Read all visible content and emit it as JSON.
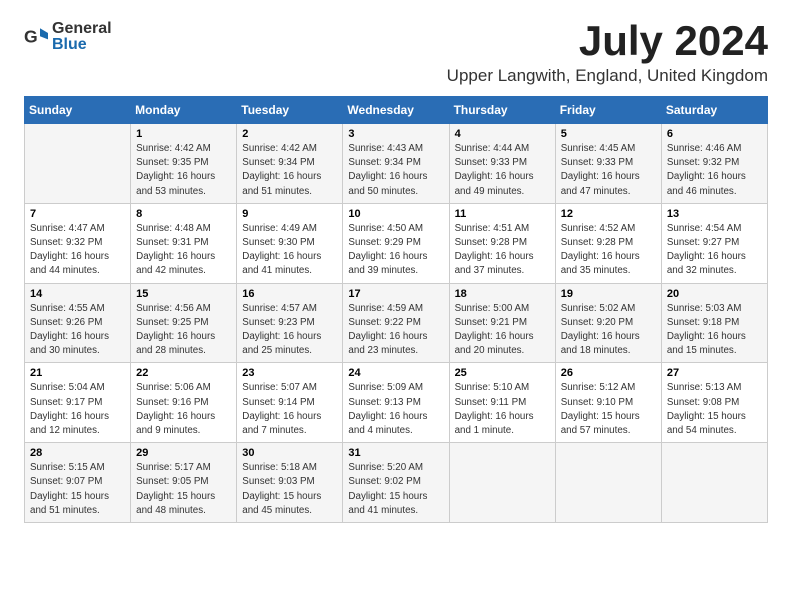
{
  "header": {
    "logo_general": "General",
    "logo_blue": "Blue",
    "month": "July 2024",
    "location": "Upper Langwith, England, United Kingdom"
  },
  "weekdays": [
    "Sunday",
    "Monday",
    "Tuesday",
    "Wednesday",
    "Thursday",
    "Friday",
    "Saturday"
  ],
  "weeks": [
    [
      {
        "day": "",
        "info": ""
      },
      {
        "day": "1",
        "info": "Sunrise: 4:42 AM\nSunset: 9:35 PM\nDaylight: 16 hours\nand 53 minutes."
      },
      {
        "day": "2",
        "info": "Sunrise: 4:42 AM\nSunset: 9:34 PM\nDaylight: 16 hours\nand 51 minutes."
      },
      {
        "day": "3",
        "info": "Sunrise: 4:43 AM\nSunset: 9:34 PM\nDaylight: 16 hours\nand 50 minutes."
      },
      {
        "day": "4",
        "info": "Sunrise: 4:44 AM\nSunset: 9:33 PM\nDaylight: 16 hours\nand 49 minutes."
      },
      {
        "day": "5",
        "info": "Sunrise: 4:45 AM\nSunset: 9:33 PM\nDaylight: 16 hours\nand 47 minutes."
      },
      {
        "day": "6",
        "info": "Sunrise: 4:46 AM\nSunset: 9:32 PM\nDaylight: 16 hours\nand 46 minutes."
      }
    ],
    [
      {
        "day": "7",
        "info": "Sunrise: 4:47 AM\nSunset: 9:32 PM\nDaylight: 16 hours\nand 44 minutes."
      },
      {
        "day": "8",
        "info": "Sunrise: 4:48 AM\nSunset: 9:31 PM\nDaylight: 16 hours\nand 42 minutes."
      },
      {
        "day": "9",
        "info": "Sunrise: 4:49 AM\nSunset: 9:30 PM\nDaylight: 16 hours\nand 41 minutes."
      },
      {
        "day": "10",
        "info": "Sunrise: 4:50 AM\nSunset: 9:29 PM\nDaylight: 16 hours\nand 39 minutes."
      },
      {
        "day": "11",
        "info": "Sunrise: 4:51 AM\nSunset: 9:28 PM\nDaylight: 16 hours\nand 37 minutes."
      },
      {
        "day": "12",
        "info": "Sunrise: 4:52 AM\nSunset: 9:28 PM\nDaylight: 16 hours\nand 35 minutes."
      },
      {
        "day": "13",
        "info": "Sunrise: 4:54 AM\nSunset: 9:27 PM\nDaylight: 16 hours\nand 32 minutes."
      }
    ],
    [
      {
        "day": "14",
        "info": "Sunrise: 4:55 AM\nSunset: 9:26 PM\nDaylight: 16 hours\nand 30 minutes."
      },
      {
        "day": "15",
        "info": "Sunrise: 4:56 AM\nSunset: 9:25 PM\nDaylight: 16 hours\nand 28 minutes."
      },
      {
        "day": "16",
        "info": "Sunrise: 4:57 AM\nSunset: 9:23 PM\nDaylight: 16 hours\nand 25 minutes."
      },
      {
        "day": "17",
        "info": "Sunrise: 4:59 AM\nSunset: 9:22 PM\nDaylight: 16 hours\nand 23 minutes."
      },
      {
        "day": "18",
        "info": "Sunrise: 5:00 AM\nSunset: 9:21 PM\nDaylight: 16 hours\nand 20 minutes."
      },
      {
        "day": "19",
        "info": "Sunrise: 5:02 AM\nSunset: 9:20 PM\nDaylight: 16 hours\nand 18 minutes."
      },
      {
        "day": "20",
        "info": "Sunrise: 5:03 AM\nSunset: 9:18 PM\nDaylight: 16 hours\nand 15 minutes."
      }
    ],
    [
      {
        "day": "21",
        "info": "Sunrise: 5:04 AM\nSunset: 9:17 PM\nDaylight: 16 hours\nand 12 minutes."
      },
      {
        "day": "22",
        "info": "Sunrise: 5:06 AM\nSunset: 9:16 PM\nDaylight: 16 hours\nand 9 minutes."
      },
      {
        "day": "23",
        "info": "Sunrise: 5:07 AM\nSunset: 9:14 PM\nDaylight: 16 hours\nand 7 minutes."
      },
      {
        "day": "24",
        "info": "Sunrise: 5:09 AM\nSunset: 9:13 PM\nDaylight: 16 hours\nand 4 minutes."
      },
      {
        "day": "25",
        "info": "Sunrise: 5:10 AM\nSunset: 9:11 PM\nDaylight: 16 hours\nand 1 minute."
      },
      {
        "day": "26",
        "info": "Sunrise: 5:12 AM\nSunset: 9:10 PM\nDaylight: 15 hours\nand 57 minutes."
      },
      {
        "day": "27",
        "info": "Sunrise: 5:13 AM\nSunset: 9:08 PM\nDaylight: 15 hours\nand 54 minutes."
      }
    ],
    [
      {
        "day": "28",
        "info": "Sunrise: 5:15 AM\nSunset: 9:07 PM\nDaylight: 15 hours\nand 51 minutes."
      },
      {
        "day": "29",
        "info": "Sunrise: 5:17 AM\nSunset: 9:05 PM\nDaylight: 15 hours\nand 48 minutes."
      },
      {
        "day": "30",
        "info": "Sunrise: 5:18 AM\nSunset: 9:03 PM\nDaylight: 15 hours\nand 45 minutes."
      },
      {
        "day": "31",
        "info": "Sunrise: 5:20 AM\nSunset: 9:02 PM\nDaylight: 15 hours\nand 41 minutes."
      },
      {
        "day": "",
        "info": ""
      },
      {
        "day": "",
        "info": ""
      },
      {
        "day": "",
        "info": ""
      }
    ]
  ]
}
